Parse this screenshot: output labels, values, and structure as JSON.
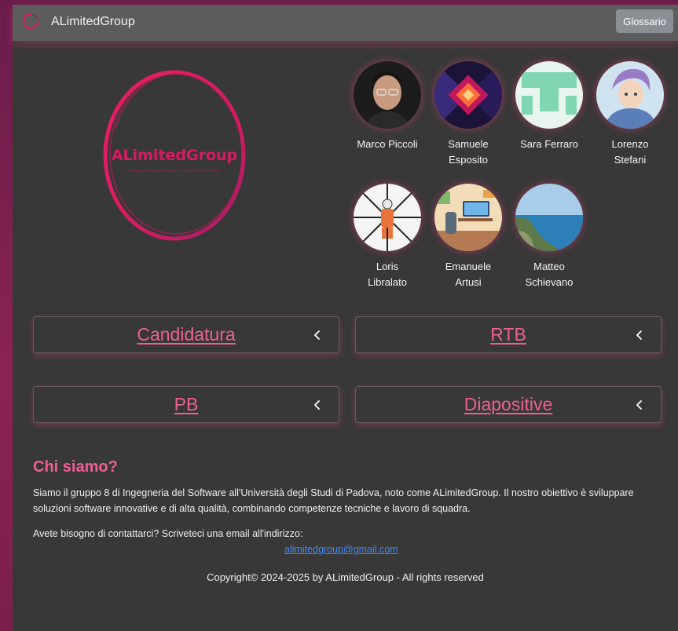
{
  "navbar": {
    "title": "ALimitedGroup",
    "logo_icon": "circle-logo-icon",
    "glossario_label": "Glossario"
  },
  "hero": {
    "logo_title": "ALimitedGroup",
    "logo_tagline": "Limited group, always committed in work"
  },
  "members": [
    {
      "name": "Marco Piccoli",
      "avatar": "man-with-glasses-photo"
    },
    {
      "name": "Samuele Esposito",
      "avatar": "abstract-neon-art"
    },
    {
      "name": "Sara Ferraro",
      "avatar": "green-geometric-avatar"
    },
    {
      "name": "Lorenzo Stefani",
      "avatar": "anime-character-art"
    },
    {
      "name": "Loris Libralato",
      "avatar": "astronaut-corridor-art"
    },
    {
      "name": "Emanuele Artusi",
      "avatar": "gaming-room-illustration"
    },
    {
      "name": "Matteo Schievano",
      "avatar": "coastline-landscape-photo"
    }
  ],
  "documents": [
    {
      "label": "Candidatura",
      "icon": "chevron-left-icon"
    },
    {
      "label": "RTB",
      "icon": "chevron-left-icon"
    },
    {
      "label": "PB",
      "icon": "chevron-left-icon"
    },
    {
      "label": "Diapositive",
      "icon": "chevron-left-icon"
    }
  ],
  "about": {
    "title": "Chi siamo?",
    "text": "Siamo il gruppo 8 di Ingegneria del Software all'Università degli Studi di Padova, noto come ALimitedGroup. Il nostro obiettivo è sviluppare soluzioni software innovative e di alta qualità, combinando competenze tecniche e lavoro di squadra.",
    "contact_text": "Avete bisogno di contattarci? Scriveteci una email all'indirizzo:",
    "email": "alimitedgroup@gmail.com"
  },
  "footer": {
    "copyright": "Copyright© 2024-2025 by ALimitedGroup - All rights reserved"
  },
  "colors": {
    "accent": "#ef5f93",
    "background": "#383838",
    "navbar": "#5c5c5c",
    "link": "#3d8bfd",
    "frame": "#7c1f4b"
  }
}
